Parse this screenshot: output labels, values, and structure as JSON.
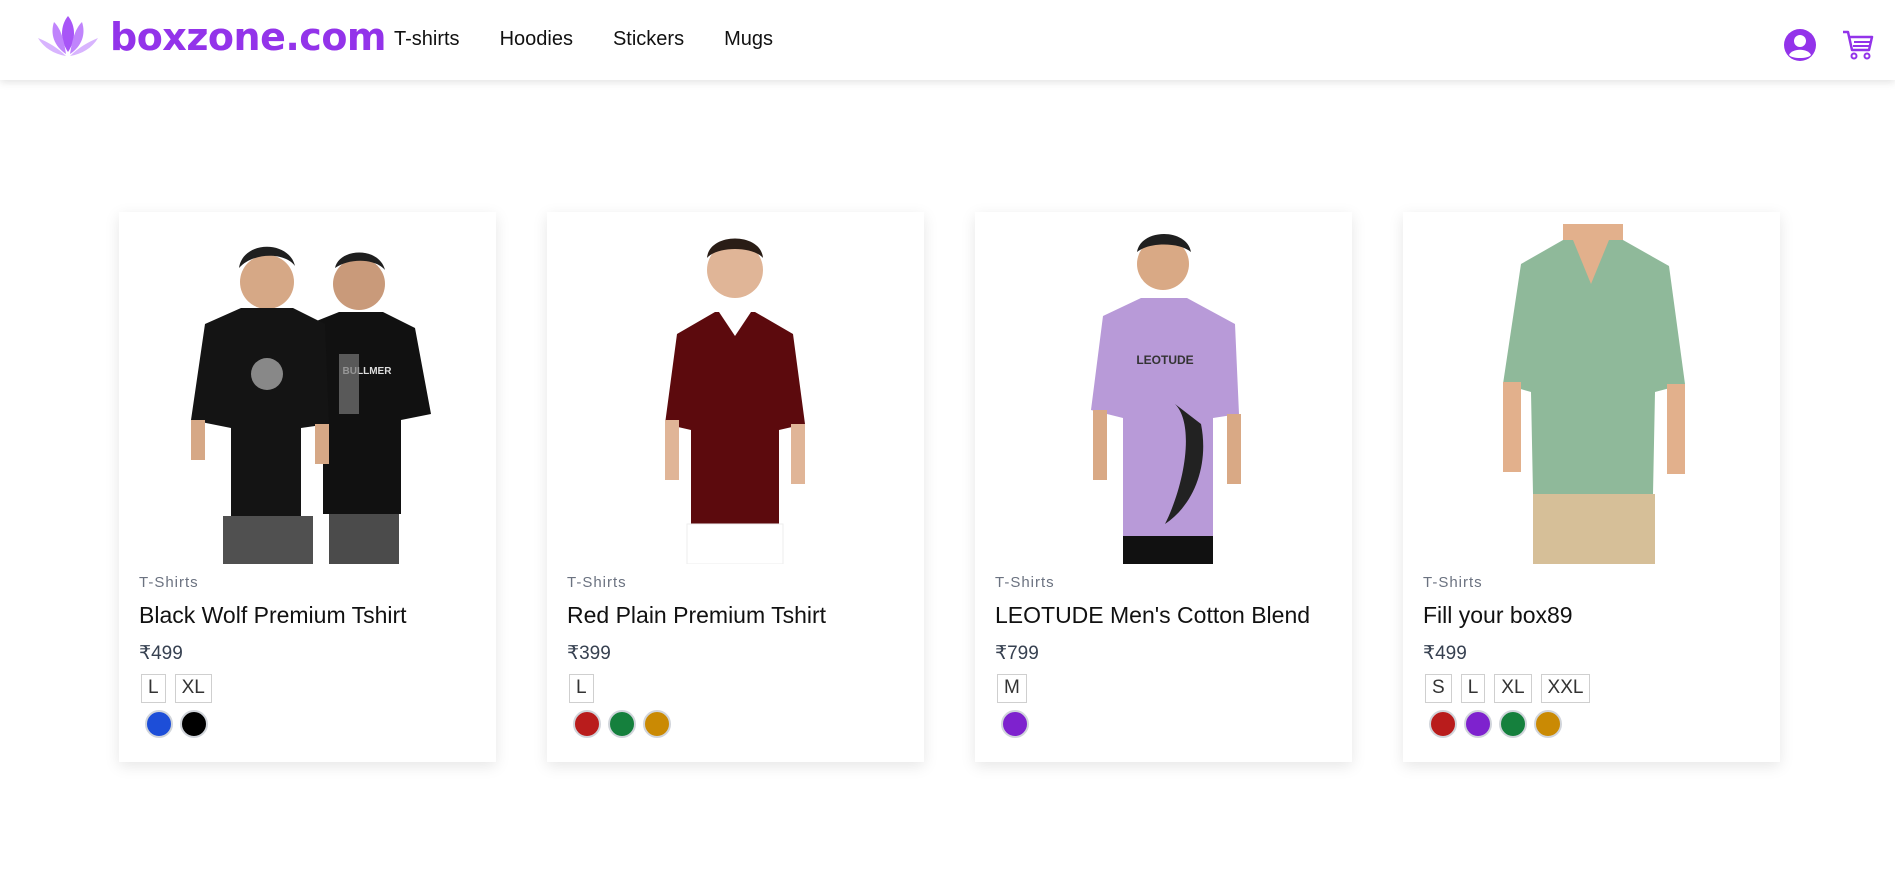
{
  "brand": {
    "name": "boxzone.com",
    "color": "#9333ea"
  },
  "nav": [
    {
      "label": "T-shirts"
    },
    {
      "label": "Hoodies"
    },
    {
      "label": "Stickers"
    },
    {
      "label": "Mugs"
    }
  ],
  "header_icons": [
    "user-icon",
    "cart-icon"
  ],
  "products": [
    {
      "category": "T-Shirts",
      "title": "Black Wolf Premium Tshirt",
      "price": "₹499",
      "sizes": [
        "L",
        "XL"
      ],
      "colors": [
        "#1d4ed8",
        "#000000"
      ]
    },
    {
      "category": "T-Shirts",
      "title": "Red Plain Premium Tshirt",
      "price": "₹399",
      "sizes": [
        "L"
      ],
      "colors": [
        "#b91c1c",
        "#15803d",
        "#ca8a04"
      ]
    },
    {
      "category": "T-Shirts",
      "title": "LEOTUDE Men's Cotton Blend",
      "price": "₹799",
      "sizes": [
        "M"
      ],
      "colors": [
        "#7e22ce"
      ]
    },
    {
      "category": "T-Shirts",
      "title": "Fill your box89",
      "price": "₹499",
      "sizes": [
        "S",
        "L",
        "XL",
        "XXL"
      ],
      "colors": [
        "#b91c1c",
        "#7e22ce",
        "#15803d",
        "#ca8a04"
      ]
    }
  ]
}
